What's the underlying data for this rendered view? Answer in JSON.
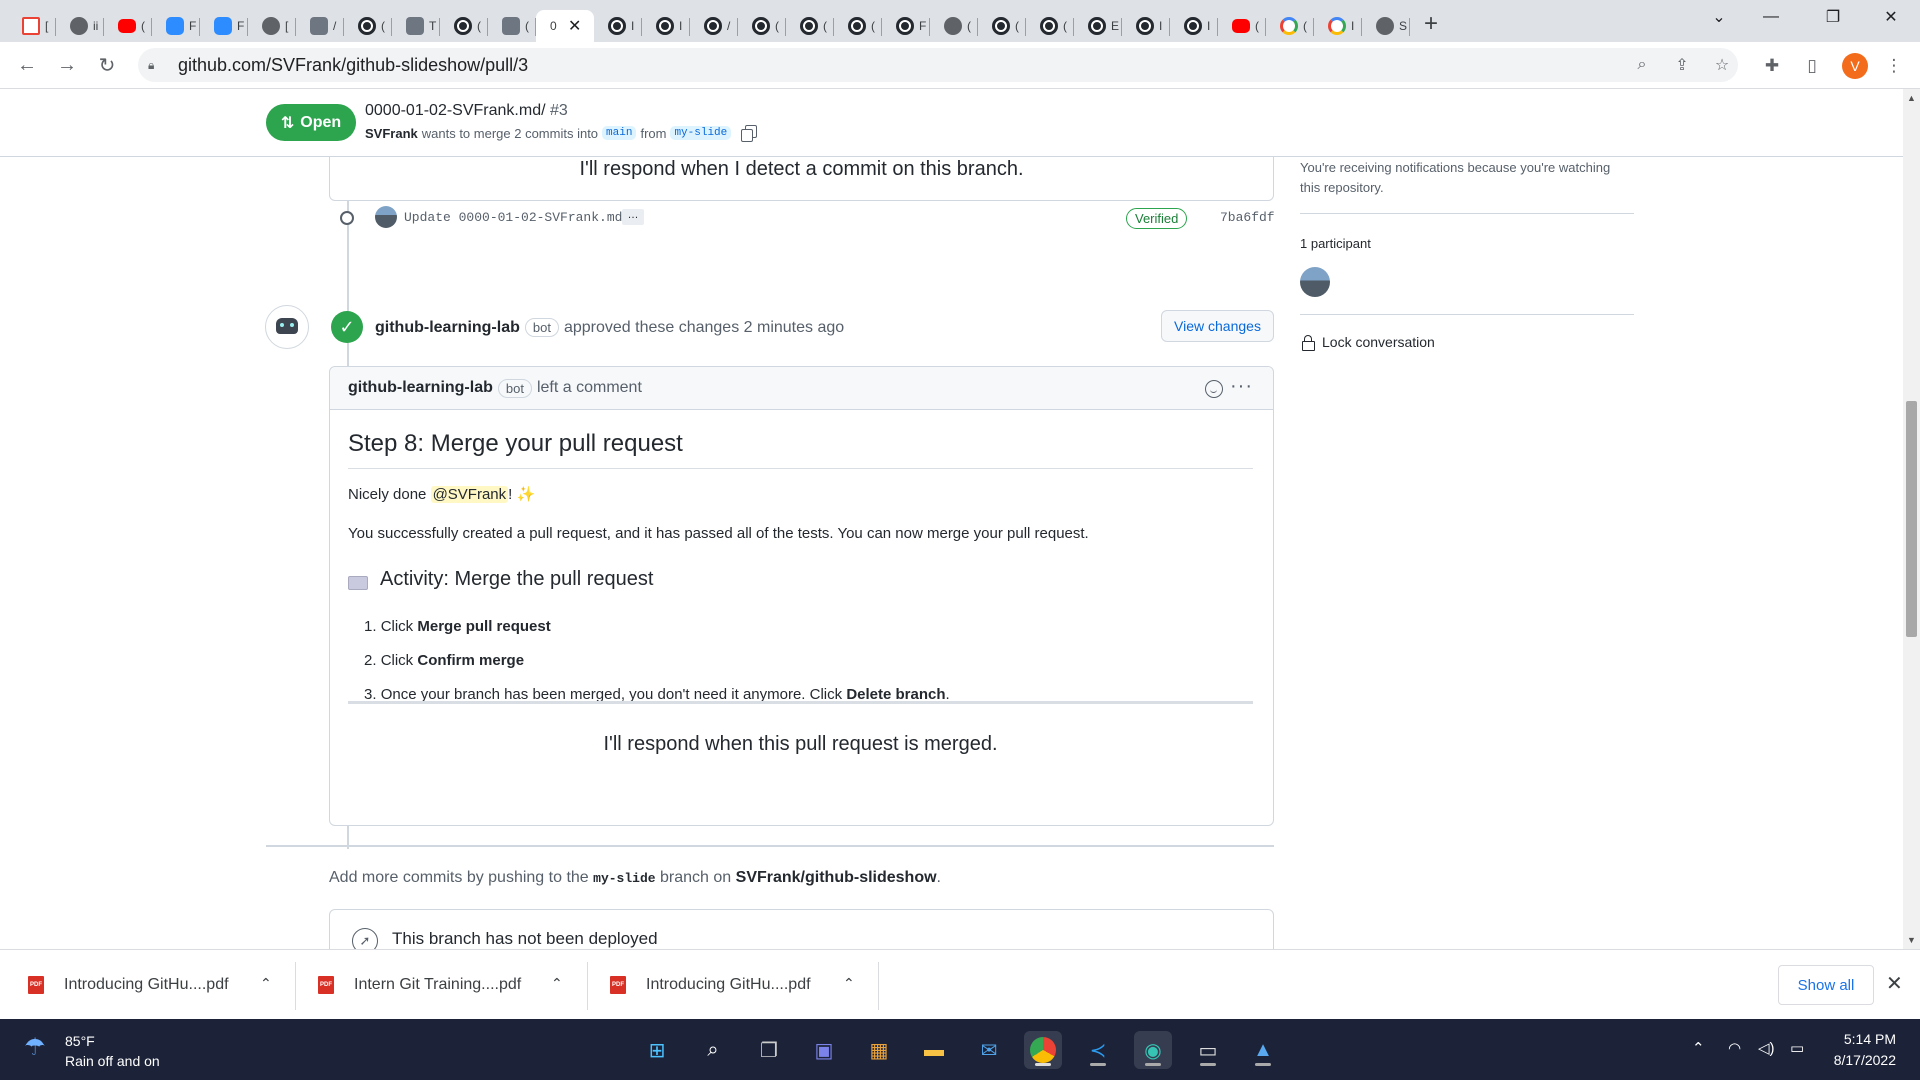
{
  "browser": {
    "tabs": [
      {
        "icon": "gmail-icon",
        "label": "["
      },
      {
        "icon": "globe-icon",
        "label": "ii"
      },
      {
        "icon": "youtube-icon",
        "label": "("
      },
      {
        "icon": "zoom-icon",
        "label": "F"
      },
      {
        "icon": "zoom-icon",
        "label": "F"
      },
      {
        "icon": "globe-icon",
        "label": "["
      },
      {
        "icon": "learning-lab-icon",
        "label": "/"
      },
      {
        "icon": "github-icon",
        "label": "("
      },
      {
        "icon": "learning-lab-icon",
        "label": "T"
      },
      {
        "icon": "github-icon",
        "label": "("
      },
      {
        "icon": "learning-lab-icon",
        "label": "("
      },
      {
        "icon": "tab-active",
        "label": "0"
      },
      {
        "icon": "github-icon",
        "label": "I"
      },
      {
        "icon": "github-icon",
        "label": "I"
      },
      {
        "icon": "github-icon",
        "label": "/"
      },
      {
        "icon": "github-icon",
        "label": "("
      },
      {
        "icon": "github-icon",
        "label": "("
      },
      {
        "icon": "github-icon",
        "label": "("
      },
      {
        "icon": "github-icon",
        "label": "F"
      },
      {
        "icon": "globe-icon",
        "label": "("
      },
      {
        "icon": "github-icon",
        "label": "("
      },
      {
        "icon": "github-icon",
        "label": "("
      },
      {
        "icon": "github-icon",
        "label": "E"
      },
      {
        "icon": "github-icon",
        "label": "I"
      },
      {
        "icon": "github-icon",
        "label": "I"
      },
      {
        "icon": "youtube-icon",
        "label": "("
      },
      {
        "icon": "google-icon",
        "label": "("
      },
      {
        "icon": "google-icon",
        "label": "I"
      },
      {
        "icon": "person-icon",
        "label": "S"
      }
    ],
    "url": "github.com/SVFrank/github-slideshow/pull/3",
    "profile_initial": "V"
  },
  "pr_header": {
    "state": "Open",
    "title": "0000-01-02-SVFrank.md/",
    "number": "#3",
    "author": "SVFrank",
    "meta_mid": "wants to merge 2 commits into",
    "base_branch": "main",
    "meta_from": "from",
    "head_branch": "my-slide"
  },
  "prev_comment_tail": "I'll respond when I detect a commit on this branch.",
  "commit": {
    "message": "Update 0000-01-02-SVFrank.md",
    "ellipsis": "…",
    "verified": "Verified",
    "sha": "7ba6fdf"
  },
  "review": {
    "author": "github-learning-lab",
    "bot_badge": "bot",
    "action": "approved these changes 2 minutes ago",
    "view_changes": "View changes"
  },
  "comment": {
    "author": "github-learning-lab",
    "bot_badge": "bot",
    "action": "left a comment",
    "heading": "Step 8: Merge your pull request",
    "nicely_prefix": "Nicely done",
    "mention": "@SVFrank",
    "nicely_suffix": "!",
    "sparkle": "✨",
    "paragraph": "You successfully created a pull request, and it has passed all of the tests. You can now merge your pull request.",
    "activity_heading": "Activity: Merge the pull request",
    "steps": [
      {
        "num": "1.",
        "text": "Click",
        "bold": "Merge pull request",
        "after": ""
      },
      {
        "num": "2.",
        "text": "Click",
        "bold": "Confirm merge",
        "after": ""
      },
      {
        "num": "3.",
        "text": "Once your branch has been merged, you don't need it anymore. Click",
        "bold": "Delete branch",
        "after": "."
      }
    ],
    "closing": "I'll respond when this pull request is merged."
  },
  "footer": {
    "add_commits_prefix": "Add more commits by pushing to the",
    "branch": "my-slide",
    "add_commits_mid": "branch on",
    "repo": "SVFrank/github-slideshow",
    "add_commits_suffix": ".",
    "deploy_title": "This branch has not been deployed"
  },
  "sidebar": {
    "notify_text": "You're receiving notifications because you're watching this repository.",
    "participants": "1 participant",
    "lock": "Lock conversation"
  },
  "downloads": {
    "items": [
      "Introducing GitHu....pdf",
      "Intern Git Training....pdf",
      "Introducing GitHu....pdf"
    ],
    "show_all": "Show all"
  },
  "taskbar": {
    "temp": "85°F",
    "weather": "Rain off and on",
    "time": "5:14 PM",
    "date": "8/17/2022"
  }
}
